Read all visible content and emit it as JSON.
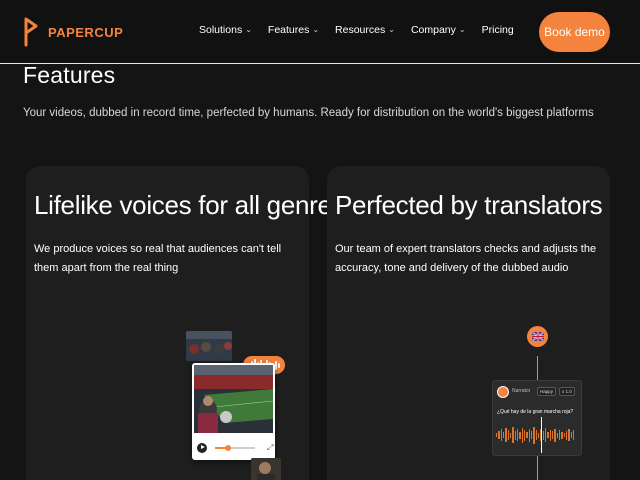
{
  "brand": {
    "name": "PAPERCUP",
    "accent": "#f4833d"
  },
  "nav": {
    "items": [
      {
        "label": "Solutions",
        "has_dropdown": true
      },
      {
        "label": "Features",
        "has_dropdown": true
      },
      {
        "label": "Resources",
        "has_dropdown": true
      },
      {
        "label": "Company",
        "has_dropdown": true
      },
      {
        "label": "Pricing",
        "has_dropdown": false
      }
    ],
    "cta_label": "Book demo"
  },
  "hero": {
    "title": "Features",
    "subtitle": "Your videos, dubbed in record time, perfected by humans. Ready for distribution on the world's biggest platforms"
  },
  "cards": [
    {
      "title": "Lifelike voices for all genres",
      "description": "We produce voices so real that audiences can't tell them apart from the real thing"
    },
    {
      "title": "Perfected by translators",
      "description": "Our team of expert translators checks and adjusts the accuracy, tone and delivery of the dubbed audio",
      "editor": {
        "speaker": "Narrator",
        "voice_option": "Happy",
        "speed_option": "x 1.0",
        "line": "¿Qué hay de la gran marcha roja?"
      }
    }
  ],
  "icons": {
    "logo": "papercup-logo-icon",
    "chevron": "chevron-down-icon",
    "play": "play-icon",
    "expand": "expand-icon",
    "flag": "uk-flag-icon",
    "waveform": "waveform-icon"
  }
}
